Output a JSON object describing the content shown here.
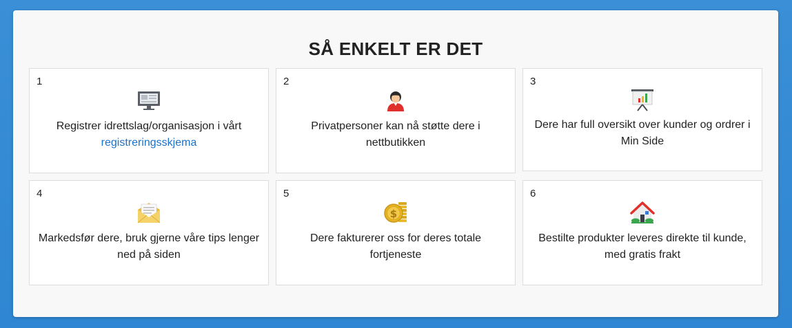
{
  "section": {
    "title": "SÅ ENKELT ER DET"
  },
  "steps": [
    {
      "number": "1",
      "text": "Registrer idrettslag/organisasjon i vårt",
      "link": "registreringsskjema",
      "icon": "monitor-icon"
    },
    {
      "number": "2",
      "text": "Privatpersoner kan nå støtte dere i nettbutikken",
      "icon": "person-icon"
    },
    {
      "number": "3",
      "text": "Dere har full oversikt over kunder og ordrer i Min Side",
      "icon": "presentation-chart-icon"
    },
    {
      "number": "4",
      "text": "Markedsfør dere, bruk gjerne våre tips lenger ned på siden",
      "icon": "envelope-icon"
    },
    {
      "number": "5",
      "text": "Dere fakturerer oss for deres totale fortjeneste",
      "icon": "coins-icon"
    },
    {
      "number": "6",
      "text": "Bestilte produkter leveres direkte til kunde, med gratis frakt",
      "icon": "house-icon"
    }
  ],
  "colors": {
    "background": "#2f86d2",
    "panel": "#f8f8f8",
    "link": "#1a72c9"
  }
}
